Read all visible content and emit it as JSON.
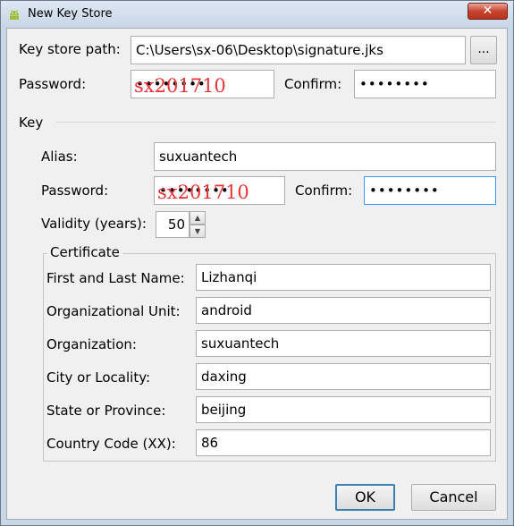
{
  "window": {
    "title": "New Key Store",
    "close_glyph": "✕"
  },
  "keystore": {
    "path_label": "Key store path:",
    "path_value": "C:\\Users\\sx-06\\Desktop\\signature.jks",
    "browse_label": "...",
    "password_label": "Password:",
    "password_masked": "••••••••",
    "password_overlay": "sx201710",
    "confirm_label": "Confirm:",
    "confirm_masked": "••••••••"
  },
  "key": {
    "section_label": "Key",
    "alias_label": "Alias:",
    "alias_value": "suxuantech",
    "password_label": "Password:",
    "password_masked": "••••••••",
    "password_overlay": "sx201710",
    "confirm_label": "Confirm:",
    "confirm_masked": "••••••••",
    "validity_label": "Validity (years):",
    "validity_value": "50",
    "spin_up_glyph": "▲",
    "spin_down_glyph": "▼"
  },
  "certificate": {
    "group_label": "Certificate",
    "fields": [
      {
        "label": "First and Last Name:",
        "value": "Lizhanqi"
      },
      {
        "label": "Organizational Unit:",
        "value": "android"
      },
      {
        "label": "Organization:",
        "value": "suxuantech"
      },
      {
        "label": "City or Locality:",
        "value": "daxing"
      },
      {
        "label": "State or Province:",
        "value": "beijing"
      },
      {
        "label": "Country Code (XX):",
        "value": "86"
      }
    ]
  },
  "buttons": {
    "ok": "OK",
    "cancel": "Cancel"
  },
  "icons": {
    "app": "android-icon"
  },
  "colors": {
    "overlay_text": "#e8353a",
    "focus_border": "#3399ff",
    "default_button_border": "#3c7fb1"
  }
}
